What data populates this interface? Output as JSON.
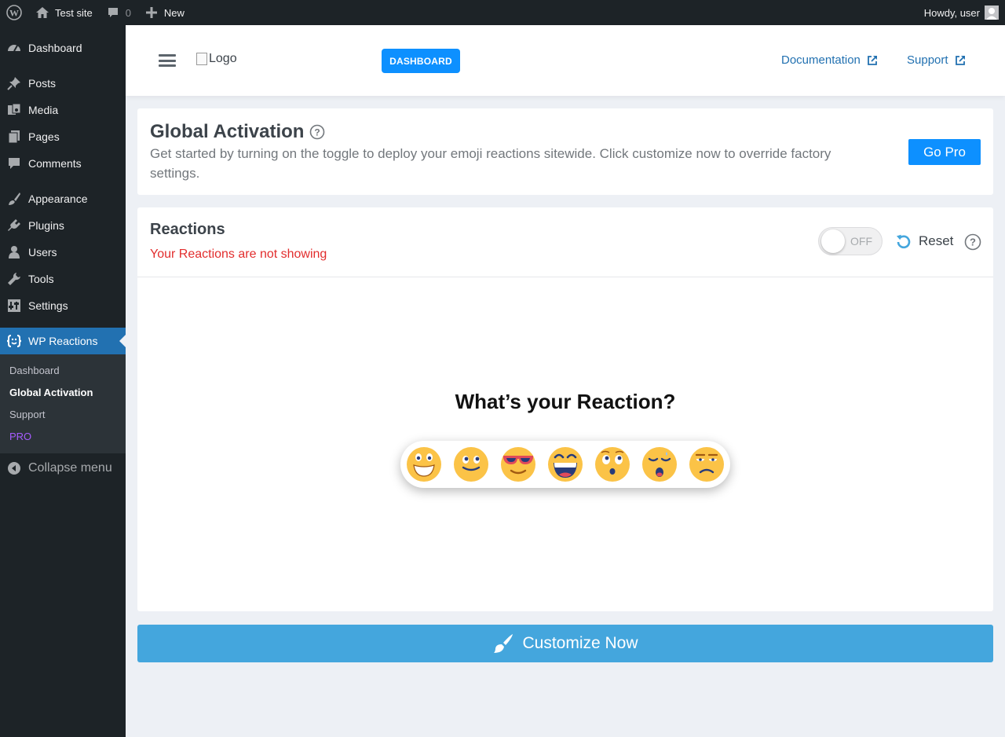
{
  "admin_bar": {
    "site_name": "Test site",
    "comments_count": "0",
    "new_label": "New",
    "greeting": "Howdy, user"
  },
  "sidebar": {
    "items": [
      {
        "label": "Dashboard",
        "icon": "dashboard-icon"
      },
      {
        "label": "Posts",
        "icon": "pin-icon"
      },
      {
        "label": "Media",
        "icon": "media-icon"
      },
      {
        "label": "Pages",
        "icon": "pages-icon"
      },
      {
        "label": "Comments",
        "icon": "comment-icon"
      },
      {
        "label": "Appearance",
        "icon": "brush-icon"
      },
      {
        "label": "Plugins",
        "icon": "plugin-icon"
      },
      {
        "label": "Users",
        "icon": "user-icon"
      },
      {
        "label": "Tools",
        "icon": "wrench-icon"
      },
      {
        "label": "Settings",
        "icon": "settings-icon"
      },
      {
        "label": "WP Reactions",
        "icon": "reactions-icon"
      }
    ],
    "submenu": [
      "Dashboard",
      "Global Activation",
      "Support",
      "PRO"
    ],
    "collapse_label": "Collapse menu"
  },
  "plugin_header": {
    "logo_alt": "Logo",
    "dashboard_button": "DASHBOARD",
    "documentation_link": "Documentation",
    "support_link": "Support"
  },
  "activation": {
    "title": "Global Activation",
    "description": "Get started by turning on the toggle to deploy your emoji reactions sitewide. Click customize now to override factory settings.",
    "go_pro_button": "Go Pro"
  },
  "reactions": {
    "title": "Reactions",
    "status": "Your Reactions are not showing",
    "toggle_label": "OFF",
    "toggle_on": false,
    "reset_label": "Reset",
    "preview_title": "What’s your Reaction?",
    "emojis": [
      "grin-emoji",
      "smile-emoji",
      "cool-emoji",
      "laugh-emoji",
      "surprised-emoji",
      "sleepy-emoji",
      "sad-emoji"
    ]
  },
  "customize_button": "Customize Now",
  "colors": {
    "accent": "#0d90ff",
    "wp_blue": "#2271b1",
    "customize_bg": "#44a6dd",
    "status_red": "#e22d2d",
    "pro_purple": "#a65cff"
  }
}
